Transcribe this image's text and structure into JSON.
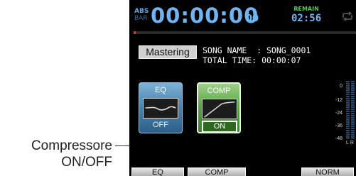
{
  "callout": {
    "line1": "Compressore",
    "line2": "ON/OFF"
  },
  "topbar": {
    "abs_label": "ABS",
    "bar_label": "BAR",
    "time": "00:00:00",
    "frames": "00",
    "remain_label": "REMAIN",
    "remain_time": "02:56",
    "loop_icon": "repeat-icon"
  },
  "progress": {
    "position_fraction": 0.01
  },
  "info": {
    "mode_tag": "Mastering",
    "song_line": "SONG NAME  : SONG_0001",
    "time_line": "TOTAL TIME: 00:00:07"
  },
  "modules": {
    "eq": {
      "title": "EQ",
      "state": "OFF"
    },
    "comp": {
      "title": "COMP",
      "state": "ON"
    }
  },
  "meter": {
    "ticks": [
      "0",
      "-12",
      "-24",
      "-36",
      "-48"
    ],
    "channels": "LR"
  },
  "function_buttons": {
    "eq": "EQ",
    "comp": "COMP",
    "norm": "NORM"
  },
  "colors": {
    "time_blue": "#6cb6f5",
    "remain_green": "#4fcf4f",
    "eq_blue": "#4a86b2",
    "comp_green": "#5aa844"
  }
}
